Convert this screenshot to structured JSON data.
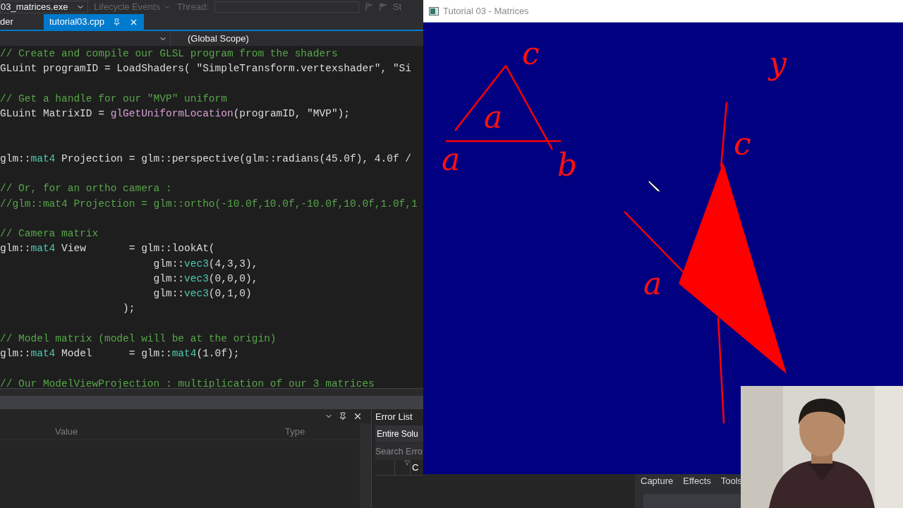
{
  "toolbar": {
    "process": "03_matrices.exe",
    "lifecycle": "Lifecycle Events",
    "thread_label": "Thread:",
    "stack_label": "St"
  },
  "tabs": [
    {
      "label": "der",
      "selected": false
    },
    {
      "label": "tutorial03.cpp",
      "selected": true
    }
  ],
  "nav_bar": {
    "scope": "(Global Scope)"
  },
  "code_lines": [
    {
      "kind": "code",
      "tokens": [
        {
          "kind": "comment",
          "text": "// Create and compile our GLSL program from the shaders"
        }
      ]
    },
    {
      "kind": "code",
      "tokens": [
        {
          "kind": "plain",
          "text": "GLuint programID = LoadShaders( \"SimpleTransform.vertexshader\", \"Si"
        }
      ]
    },
    {
      "kind": "blank"
    },
    {
      "kind": "code",
      "tokens": [
        {
          "kind": "comment",
          "text": "// Get a handle for our \"MVP\" uniform"
        }
      ]
    },
    {
      "kind": "code",
      "tokens": [
        {
          "kind": "plain",
          "text": "GLuint MatrixID = "
        },
        {
          "kind": "macro",
          "text": "glGetUniformLocation"
        },
        {
          "kind": "plain",
          "text": "(programID, \"MVP\");"
        }
      ]
    },
    {
      "kind": "blank"
    },
    {
      "kind": "blank"
    },
    {
      "kind": "code",
      "tokens": [
        {
          "kind": "plain",
          "text": "glm::"
        },
        {
          "kind": "type",
          "text": "mat4"
        },
        {
          "kind": "plain",
          "text": " Projection = glm::perspective(glm::radians(45.0f), 4.0f /"
        }
      ]
    },
    {
      "kind": "blank"
    },
    {
      "kind": "code",
      "tokens": [
        {
          "kind": "comment",
          "text": "// Or, for an ortho camera :"
        }
      ]
    },
    {
      "kind": "code",
      "tokens": [
        {
          "kind": "comment",
          "text": "//glm::mat4 Projection = glm::ortho(-10.0f,10.0f,-10.0f,10.0f,1.0f,1"
        }
      ]
    },
    {
      "kind": "blank"
    },
    {
      "kind": "code",
      "tokens": [
        {
          "kind": "comment",
          "text": "// Camera matrix"
        }
      ]
    },
    {
      "kind": "code",
      "tokens": [
        {
          "kind": "plain",
          "text": "glm::"
        },
        {
          "kind": "type",
          "text": "mat4"
        },
        {
          "kind": "plain",
          "text": " View       = glm::lookAt("
        }
      ]
    },
    {
      "kind": "code",
      "tokens": [
        {
          "kind": "plain",
          "text": "                         glm::"
        },
        {
          "kind": "type",
          "text": "vec3"
        },
        {
          "kind": "plain",
          "text": "(4,3,3),"
        }
      ]
    },
    {
      "kind": "code",
      "tokens": [
        {
          "kind": "plain",
          "text": "                         glm::"
        },
        {
          "kind": "type",
          "text": "vec3"
        },
        {
          "kind": "plain",
          "text": "(0,0,0),"
        }
      ]
    },
    {
      "kind": "code",
      "tokens": [
        {
          "kind": "plain",
          "text": "                         glm::"
        },
        {
          "kind": "type",
          "text": "vec3"
        },
        {
          "kind": "plain",
          "text": "(0,1,0)"
        }
      ]
    },
    {
      "kind": "code",
      "tokens": [
        {
          "kind": "plain",
          "text": "                    );"
        }
      ]
    },
    {
      "kind": "blank"
    },
    {
      "kind": "code",
      "tokens": [
        {
          "kind": "comment",
          "text": "// Model matrix (model will be at the origin)"
        }
      ]
    },
    {
      "kind": "code",
      "tokens": [
        {
          "kind": "plain",
          "text": "glm::"
        },
        {
          "kind": "type",
          "text": "mat4"
        },
        {
          "kind": "plain",
          "text": " Model      = glm::"
        },
        {
          "kind": "type",
          "text": "mat4"
        },
        {
          "kind": "plain",
          "text": "(1.0f);"
        }
      ]
    },
    {
      "kind": "blank"
    },
    {
      "kind": "code",
      "tokens": [
        {
          "kind": "comment",
          "text": "// Our ModelViewProjection : multiplication of our 3 matrices"
        }
      ]
    }
  ],
  "locals_panel": {
    "columns": [
      "Value",
      "Type"
    ]
  },
  "error_list": {
    "title": "Error List",
    "scope": "Entire Solu",
    "search_placeholder": "Search Erro",
    "column_3": "C"
  },
  "gl_window": {
    "title": "Tutorial 03 - Matrices",
    "annotations": [
      "c",
      "a",
      "a",
      "b",
      "y",
      "c",
      "a"
    ]
  },
  "recorder_menu": [
    "Capture",
    "Effects",
    "Tools"
  ]
}
